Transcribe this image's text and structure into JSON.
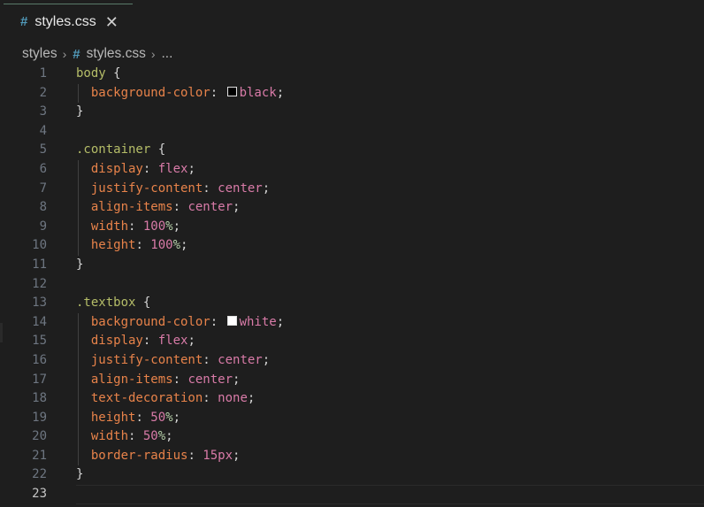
{
  "tab": {
    "title": "styles.css",
    "icon": "#",
    "close": "✕"
  },
  "breadcrumb": {
    "folder": "styles",
    "file": "styles.css",
    "rest": "..."
  },
  "lines": [
    {
      "n": "1",
      "tokens": [
        [
          "sel",
          "body"
        ],
        [
          "punct",
          " {"
        ]
      ]
    },
    {
      "n": "2",
      "tokens": [
        [
          "ind",
          "  "
        ],
        [
          "prop",
          "background-color"
        ],
        [
          "punct",
          ": "
        ],
        [
          "swatch",
          "#000000"
        ],
        [
          "val",
          "black"
        ],
        [
          "punct",
          ";"
        ]
      ]
    },
    {
      "n": "3",
      "tokens": [
        [
          "punct",
          "}"
        ]
      ]
    },
    {
      "n": "4",
      "tokens": []
    },
    {
      "n": "5",
      "tokens": [
        [
          "sel",
          ".container"
        ],
        [
          "punct",
          " {"
        ]
      ]
    },
    {
      "n": "6",
      "tokens": [
        [
          "ind",
          "  "
        ],
        [
          "prop",
          "display"
        ],
        [
          "punct",
          ": "
        ],
        [
          "val",
          "flex"
        ],
        [
          "punct",
          ";"
        ]
      ]
    },
    {
      "n": "7",
      "tokens": [
        [
          "ind",
          "  "
        ],
        [
          "prop",
          "justify-content"
        ],
        [
          "punct",
          ": "
        ],
        [
          "val",
          "center"
        ],
        [
          "punct",
          ";"
        ]
      ]
    },
    {
      "n": "8",
      "tokens": [
        [
          "ind",
          "  "
        ],
        [
          "prop",
          "align-items"
        ],
        [
          "punct",
          ": "
        ],
        [
          "val",
          "center"
        ],
        [
          "punct",
          ";"
        ]
      ]
    },
    {
      "n": "9",
      "tokens": [
        [
          "ind",
          "  "
        ],
        [
          "prop",
          "width"
        ],
        [
          "punct",
          ": "
        ],
        [
          "num",
          "100"
        ],
        [
          "unit",
          "%"
        ],
        [
          "punct",
          ";"
        ]
      ]
    },
    {
      "n": "10",
      "tokens": [
        [
          "ind",
          "  "
        ],
        [
          "prop",
          "height"
        ],
        [
          "punct",
          ": "
        ],
        [
          "num",
          "100"
        ],
        [
          "unit",
          "%"
        ],
        [
          "punct",
          ";"
        ]
      ]
    },
    {
      "n": "11",
      "tokens": [
        [
          "punct",
          "}"
        ]
      ]
    },
    {
      "n": "12",
      "tokens": []
    },
    {
      "n": "13",
      "tokens": [
        [
          "sel",
          ".textbox"
        ],
        [
          "punct",
          " {"
        ]
      ]
    },
    {
      "n": "14",
      "tokens": [
        [
          "ind",
          "  "
        ],
        [
          "prop",
          "background-color"
        ],
        [
          "punct",
          ": "
        ],
        [
          "swatch",
          "#ffffff"
        ],
        [
          "val",
          "white"
        ],
        [
          "punct",
          ";"
        ]
      ]
    },
    {
      "n": "15",
      "tokens": [
        [
          "ind",
          "  "
        ],
        [
          "prop",
          "display"
        ],
        [
          "punct",
          ": "
        ],
        [
          "val",
          "flex"
        ],
        [
          "punct",
          ";"
        ]
      ]
    },
    {
      "n": "16",
      "tokens": [
        [
          "ind",
          "  "
        ],
        [
          "prop",
          "justify-content"
        ],
        [
          "punct",
          ": "
        ],
        [
          "val",
          "center"
        ],
        [
          "punct",
          ";"
        ]
      ]
    },
    {
      "n": "17",
      "tokens": [
        [
          "ind",
          "  "
        ],
        [
          "prop",
          "align-items"
        ],
        [
          "punct",
          ": "
        ],
        [
          "val",
          "center"
        ],
        [
          "punct",
          ";"
        ]
      ]
    },
    {
      "n": "18",
      "tokens": [
        [
          "ind",
          "  "
        ],
        [
          "prop",
          "text-decoration"
        ],
        [
          "punct",
          ": "
        ],
        [
          "val",
          "none"
        ],
        [
          "punct",
          ";"
        ]
      ]
    },
    {
      "n": "19",
      "tokens": [
        [
          "ind",
          "  "
        ],
        [
          "prop",
          "height"
        ],
        [
          "punct",
          ": "
        ],
        [
          "num",
          "50"
        ],
        [
          "unit",
          "%"
        ],
        [
          "punct",
          ";"
        ]
      ]
    },
    {
      "n": "20",
      "tokens": [
        [
          "ind",
          "  "
        ],
        [
          "prop",
          "width"
        ],
        [
          "punct",
          ": "
        ],
        [
          "num",
          "50"
        ],
        [
          "unit",
          "%"
        ],
        [
          "punct",
          ";"
        ]
      ]
    },
    {
      "n": "21",
      "tokens": [
        [
          "ind",
          "  "
        ],
        [
          "prop",
          "border-radius"
        ],
        [
          "punct",
          ": "
        ],
        [
          "num",
          "15"
        ],
        [
          "val",
          "px"
        ],
        [
          "punct",
          ";"
        ]
      ]
    },
    {
      "n": "22",
      "tokens": [
        [
          "punct",
          "}"
        ]
      ]
    },
    {
      "n": "23",
      "tokens": [],
      "current": true
    }
  ]
}
